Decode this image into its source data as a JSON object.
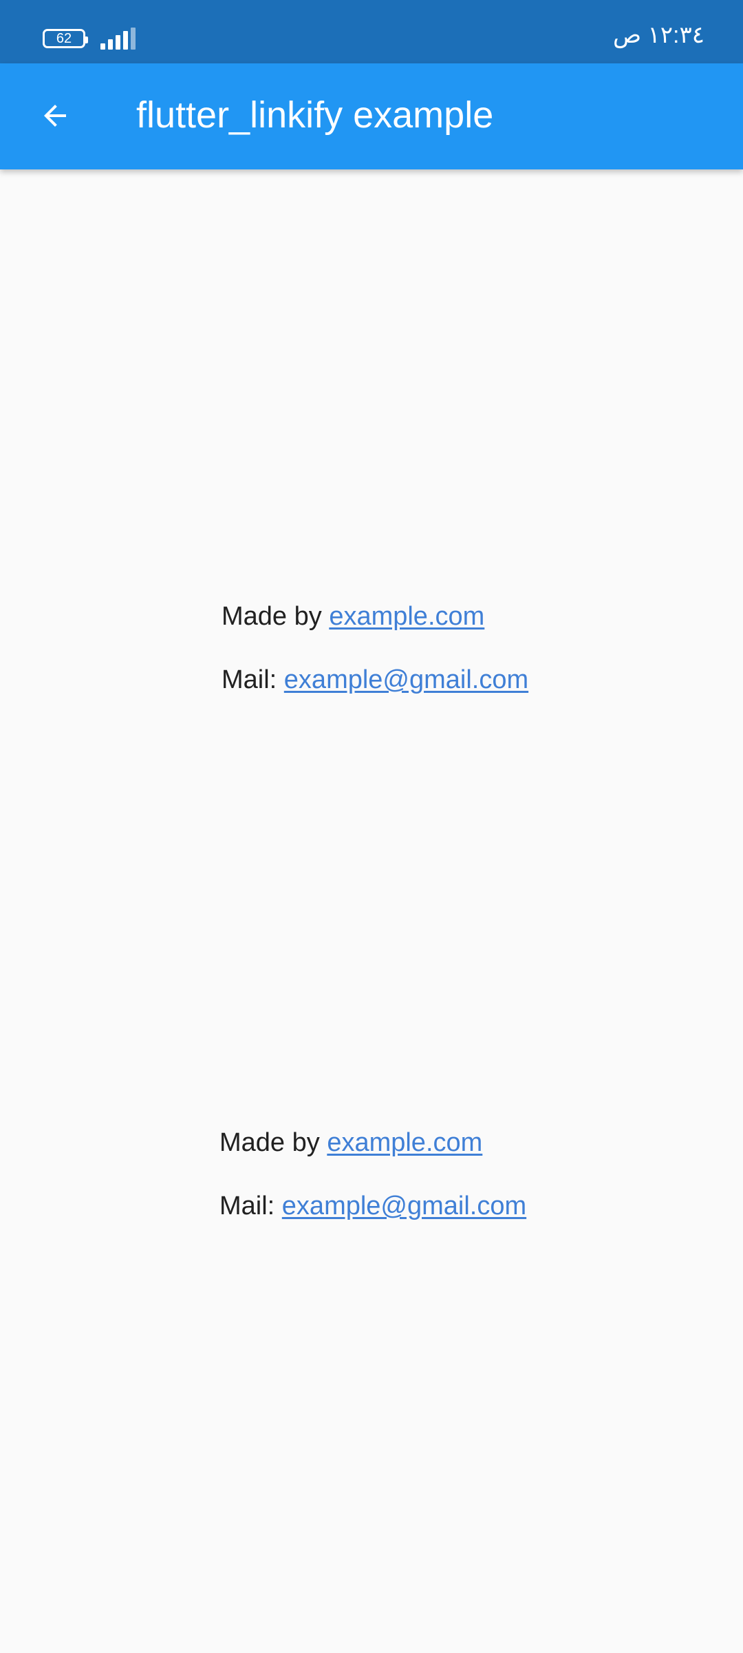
{
  "status_bar": {
    "battery_level": "62",
    "time": "١٢:٣٤ ص",
    "signal_bars": 4,
    "background_color": "#1c6fb8"
  },
  "app_bar": {
    "title": "flutter_linkify example",
    "back_icon": "arrow-back-icon",
    "background_color": "#2196f3"
  },
  "blocks": [
    {
      "made_by_prefix": "Made by",
      "made_by_link": "example.com",
      "mail_prefix": "Mail:",
      "mail_link": "example@gmail.com"
    },
    {
      "made_by_prefix": "Made by",
      "made_by_link": "example.com",
      "mail_prefix": "Mail:",
      "mail_link": "example@gmail.com"
    }
  ],
  "colors": {
    "link": "#3f7fd6",
    "text": "#212121",
    "background": "#fafafa"
  }
}
